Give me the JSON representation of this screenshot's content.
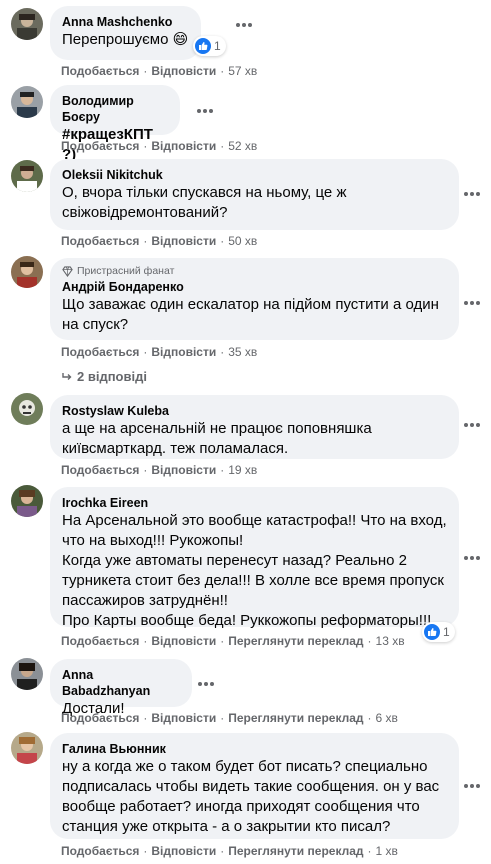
{
  "colors": {
    "bubble": "#f0f2f5",
    "meta": "#65676b",
    "like": "#1877f2"
  },
  "comments": [
    {
      "author": "Anna Mashchenko",
      "text": "Перепрошуємо",
      "emoji": "😄",
      "like_label": "Подобається",
      "reply_label": "Відповісти",
      "time": "57 хв",
      "reactions": "1"
    },
    {
      "author": "Володимир Боєру",
      "text": "#кращезКПТ ?)",
      "like_label": "Подобається",
      "reply_label": "Відповісти",
      "time": "52 хв"
    },
    {
      "author": "Oleksii Nikitchuk",
      "text": "О, вчора тільки спускався на ньому, це ж свіжовідремонтований?",
      "like_label": "Подобається",
      "reply_label": "Відповісти",
      "time": "50 хв"
    },
    {
      "badge": "Пристрасний фанат",
      "author": "Андрій Бондаренко",
      "text": "Що заважає один ескалатор на підйом пустити а один на спуск?",
      "like_label": "Подобається",
      "reply_label": "Відповісти",
      "time": "35 хв"
    },
    {
      "author": "Rostyslaw Kuleba",
      "text": "а ще на арсенальній не працює поповняшка київсмарткард. теж поламалася.",
      "like_label": "Подобається",
      "reply_label": "Відповісти",
      "time": "19 хв"
    },
    {
      "author": "Irochka Eireen",
      "text": "На Арсенальной это вообще катастрофа!! Что на вход, что на выход!!! Рукожопы!\nКогда уже автоматы перенесут назад? Реально 2 турникета стоит без дела!!! В холле все время пропуск пассажиров затруднён!!\nПро Карты вообще беда! Руккожопы реформаторы!!!",
      "like_label": "Подобається",
      "reply_label": "Відповісти",
      "translate_label": "Переглянути переклад",
      "time": "13 хв",
      "reactions": "1"
    },
    {
      "author": "Anna Babadzhanyan",
      "text": "Достали!",
      "like_label": "Подобається",
      "reply_label": "Відповісти",
      "translate_label": "Переглянути переклад",
      "time": "6 хв"
    },
    {
      "author": "Галина Вьюнник",
      "text": "ну а когда же о таком будет бот писать? специально подписалась чтобы видеть такие сообщения. он у вас вообще работает? иногда приходят сообщения что станция уже открыта - а о закрытии кто писал?",
      "like_label": "Подобається",
      "reply_label": "Відповісти",
      "translate_label": "Переглянути переклад",
      "time": "1 хв"
    }
  ],
  "replies_toggle": "2 відповіді"
}
